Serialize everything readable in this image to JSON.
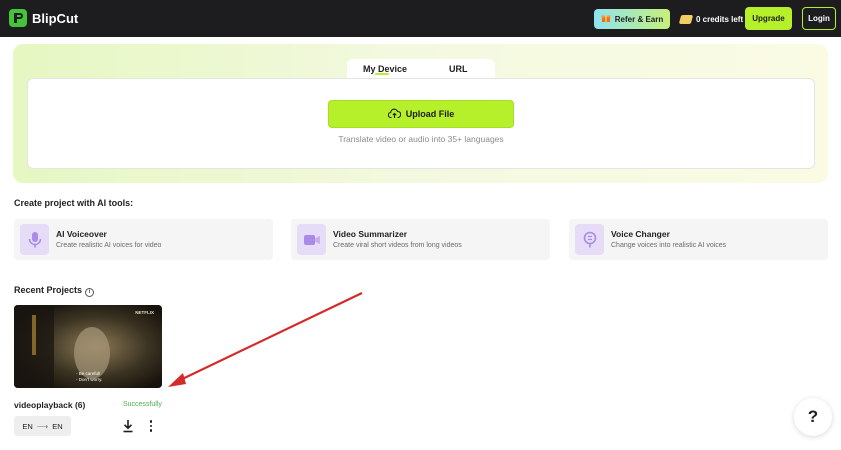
{
  "app": {
    "name": "BlipCut"
  },
  "header": {
    "refer_label": "Refer & Earn",
    "credits_label": "0 credits left",
    "upgrade_label": "Upgrade",
    "login_label": "Login"
  },
  "upload": {
    "tabs": [
      {
        "label": "My Device",
        "active": true
      },
      {
        "label": "URL",
        "active": false
      }
    ],
    "button_label": "Upload File",
    "hint": "Translate video or audio into 35+ languages"
  },
  "tools": {
    "title": "Create project with AI tools:",
    "items": [
      {
        "name": "AI Voiceover",
        "desc": "Create realistic AI voices for video",
        "icon": "microphone-icon"
      },
      {
        "name": "Video Summarizer",
        "desc": "Create viral short videos from long videos",
        "icon": "video-summarizer-icon"
      },
      {
        "name": "Voice Changer",
        "desc": "Change voices into realistic AI voices",
        "icon": "voice-changer-icon"
      }
    ]
  },
  "recent": {
    "title": "Recent Projects",
    "projects": [
      {
        "name": "videoplayback (6)",
        "status": "Successfully",
        "thumb_logo": "NETFLIX",
        "subtitle_lines": [
          "- Be careful!",
          "- Don't worry."
        ],
        "source_lang": "EN",
        "target_lang": "EN"
      }
    ]
  },
  "help": {
    "label": "?"
  },
  "colors": {
    "accent": "#b6f02b",
    "topbar": "#1d1d1f",
    "success": "#4caf50",
    "annotation": "#d42a2a"
  }
}
